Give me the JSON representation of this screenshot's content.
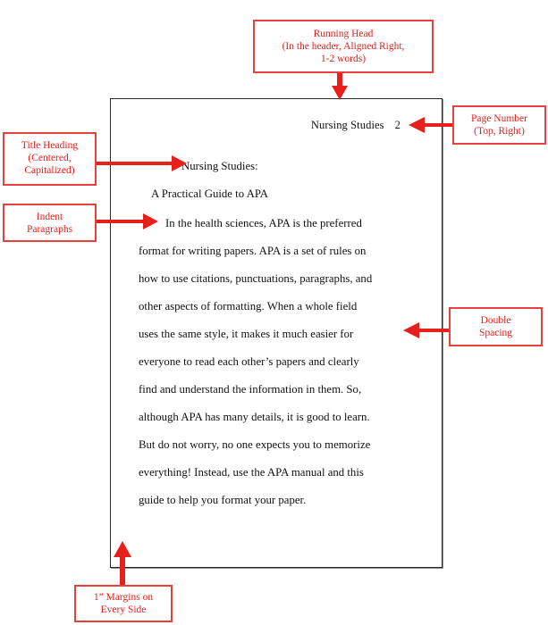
{
  "figure": {
    "type": "apa-format-annotated-sample-page",
    "accent_color": "#e8201c",
    "border_color": "#e8413c",
    "page_border_color": "#2b2b2b"
  },
  "document": {
    "header": {
      "running_head": "Nursing Studies",
      "page_number": "2"
    },
    "title": {
      "line1": "Nursing Studies:",
      "line2": "A Practical Guide to APA"
    },
    "paragraph_lines": [
      "In the health sciences, APA is the preferred",
      "format for writing papers.  APA is a set of rules on",
      "how to use citations, punctuations, paragraphs, and",
      "other aspects of formatting.  When a whole field",
      "uses the same style, it makes it much easier for",
      "everyone to read each other’s papers and clearly",
      "find and understand the information in them.  So,",
      "although APA has many details, it is good to learn.",
      "But do not worry, no one expects you to memorize",
      "everything!  Instead, use the APA manual and this",
      "guide to help you format your paper."
    ]
  },
  "callouts": {
    "running_head": {
      "line1": "Running Head",
      "line2": "(In the header, Aligned Right,",
      "line3": "1-2 words)"
    },
    "page_number": {
      "line1": "Page Number",
      "line2": "(Top, Right)"
    },
    "title_heading": {
      "line1": "Title Heading",
      "line2": "(Centered,",
      "line3": "Capitalized)"
    },
    "indent": {
      "line1": "Indent",
      "line2": "Paragraphs"
    },
    "double_spacing": {
      "line1": "Double",
      "line2": "Spacing"
    },
    "margins": {
      "line1": "1” Margins on",
      "line2": "Every Side"
    }
  }
}
